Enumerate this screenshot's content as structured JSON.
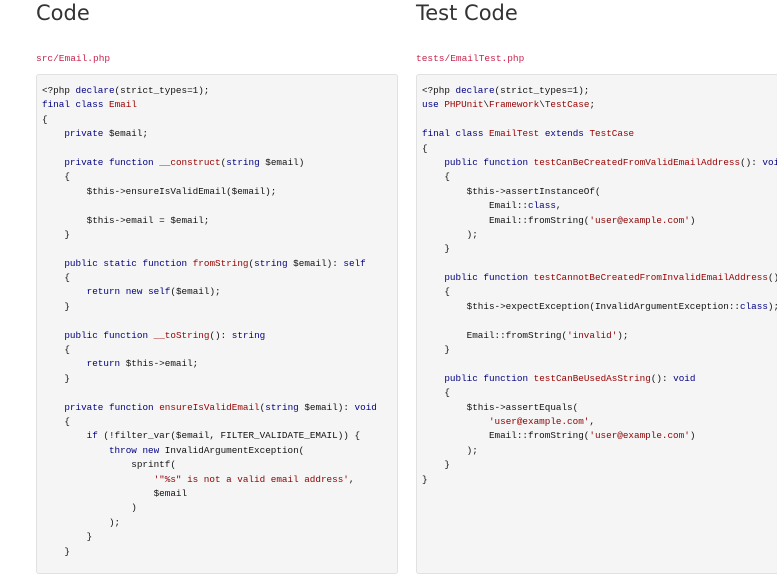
{
  "left": {
    "title": "Code",
    "path": "src/Email.php",
    "lines": [
      "<?php declare(strict_types=1);",
      "final class Email",
      "{",
      "    private $email;",
      "",
      "    private function __construct(string $email)",
      "    {",
      "        $this->ensureIsValidEmail($email);",
      "",
      "        $this->email = $email;",
      "    }",
      "",
      "    public static function fromString(string $email): self",
      "    {",
      "        return new self($email);",
      "    }",
      "",
      "    public function __toString(): string",
      "    {",
      "        return $this->email;",
      "    }",
      "",
      "    private function ensureIsValidEmail(string $email): void",
      "    {",
      "        if (!filter_var($email, FILTER_VALIDATE_EMAIL)) {",
      "            throw new InvalidArgumentException(",
      "                sprintf(",
      "                    '\"%s\" is not a valid email address',",
      "                    $email",
      "                )",
      "            );",
      "        }",
      "    }"
    ]
  },
  "right": {
    "title": "Test Code",
    "path": "tests/EmailTest.php",
    "lines": [
      "<?php declare(strict_types=1);",
      "use PHPUnit\\Framework\\TestCase;",
      "",
      "final class EmailTest extends TestCase",
      "{",
      "    public function testCanBeCreatedFromValidEmailAddress(): void",
      "    {",
      "        $this->assertInstanceOf(",
      "            Email::class,",
      "            Email::fromString('user@example.com')",
      "        );",
      "    }",
      "",
      "    public function testCannotBeCreatedFromInvalidEmailAddress(): void",
      "    {",
      "        $this->expectException(InvalidArgumentException::class);",
      "",
      "        Email::fromString('invalid');",
      "    }",
      "",
      "    public function testCanBeUsedAsString(): void",
      "    {",
      "        $this->assertEquals(",
      "            'user@example.com',",
      "            Email::fromString('user@example.com')",
      "        );",
      "    }",
      "}"
    ]
  }
}
